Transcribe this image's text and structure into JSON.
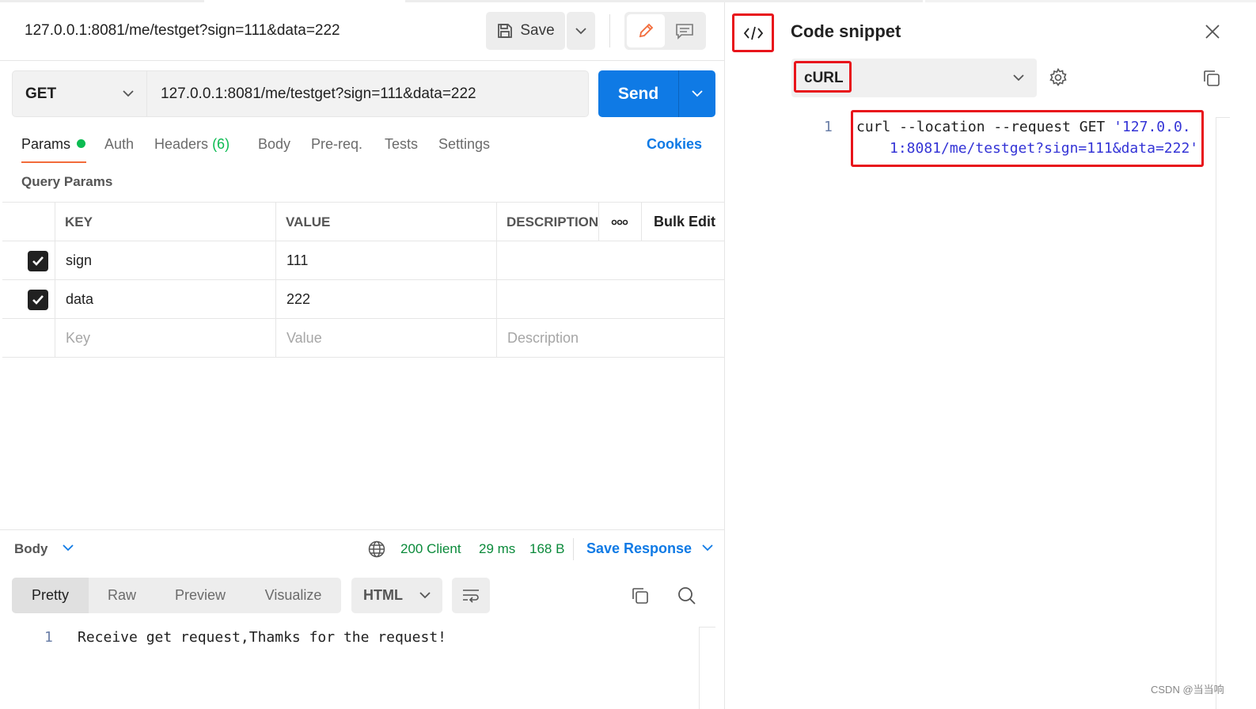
{
  "request": {
    "title": "127.0.0.1:8081/me/testget?sign=111&data=222",
    "save_label": "Save",
    "method": "GET",
    "url": "127.0.0.1:8081/me/testget?sign=111&data=222",
    "send_label": "Send"
  },
  "tabs": [
    {
      "label": "Params"
    },
    {
      "label": "Auth"
    },
    {
      "label": "Headers",
      "count": "(6)"
    },
    {
      "label": "Body"
    },
    {
      "label": "Pre-req."
    },
    {
      "label": "Tests"
    },
    {
      "label": "Settings"
    }
  ],
  "cookies_label": "Cookies",
  "query_params": {
    "title": "Query Params",
    "headers": {
      "key": "KEY",
      "value": "VALUE",
      "description": "DESCRIPTION",
      "bulk_edit": "Bulk Edit"
    },
    "rows": [
      {
        "key": "sign",
        "value": "111",
        "checked": true
      },
      {
        "key": "data",
        "value": "222",
        "checked": true
      }
    ],
    "placeholders": {
      "key": "Key",
      "value": "Value",
      "description": "Description"
    }
  },
  "response": {
    "body_label": "Body",
    "status": "200 Client",
    "time": "29 ms",
    "size": "168 B",
    "save_response": "Save Response",
    "view_modes": [
      "Pretty",
      "Raw",
      "Preview",
      "Visualize"
    ],
    "format": "HTML",
    "line_number": "1",
    "body_text": "Receive get request,Thamks for the request!"
  },
  "code_snippet": {
    "title": "Code snippet",
    "language": "cURL",
    "line_number": "1",
    "code_plain": "curl --location --request GET ",
    "code_string_1": "'127.0.0.",
    "code_string_2": "1:8081/me/testget?sign=111&data=222'"
  },
  "watermark": "CSDN @当当响",
  "colors": {
    "accent": "#0f7ae5",
    "highlight": "#e8141b",
    "success": "#0cbb52",
    "tab_underline": "#f26b3a"
  }
}
